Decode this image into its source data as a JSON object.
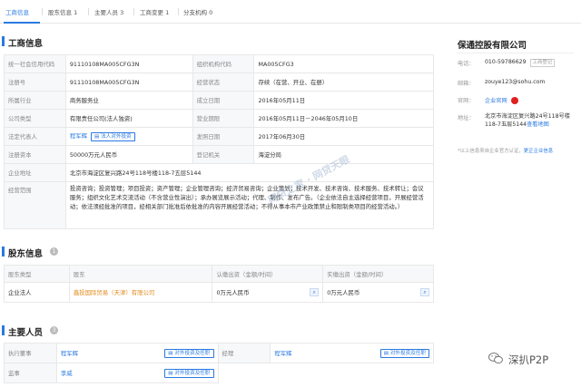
{
  "tabs": [
    {
      "label": "工商信息"
    },
    {
      "label": "股东信息 1"
    },
    {
      "label": "主要人员 3"
    },
    {
      "label": "工商变更 1"
    },
    {
      "label": "分支机构 0"
    }
  ],
  "business": {
    "title": "工商信息",
    "credit_code_label": "统一社会信用代码",
    "credit_code": "91110108MA005CFG3N",
    "org_code_label": "组织机构代码",
    "org_code": "MA005CFG3",
    "reg_no_label": "注册号",
    "reg_no": "91110108MA005CFG3N",
    "status_label": "经营状态",
    "status": "存续（在营、开业、在册）",
    "industry_label": "所属行业",
    "industry": "商务服务业",
    "founded_label": "成立日期",
    "founded": "2016年05月11日",
    "type_label": "公司类型",
    "type": "有限责任公司(法人独资)",
    "term_label": "营业期限",
    "term": "2016年05月11日－2046年05月10日",
    "legal_rep_label": "法定代表人",
    "legal_rep": "程军辉",
    "legal_rep_btn": "法人对外投资",
    "issue_date_label": "发照日期",
    "issue_date": "2017年06月30日",
    "capital_label": "注册资本",
    "capital": "50000万元人民币",
    "authority_label": "登记机关",
    "authority": "海淀分局",
    "address_label": "企业地址",
    "address": "北京市海淀区复兴路24号118号楼118-7五层5144",
    "scope_label": "经营范围",
    "scope": "投资咨询；投资管理；项目投资；资产管理；企业管理咨询；经济贸易咨询；企业策划；技术开发、技术咨询、技术服务、技术转让；会议服务；组织文化艺术交流活动（不含营业性演出）；承办展览展示活动；代理、制作、发布广告。（企业依法自主选择经营项目，开展经营活动；依法须经批准的项目，经相关部门批准后依批准的内容开展经营活动；不得从事本市产业政策禁止和限制类项目的经营活动。）"
  },
  "shareholders": {
    "title": "股东信息",
    "count": "1",
    "headers": [
      "股东类型",
      "股东",
      "认缴出资（金额/时间）",
      "实缴出资（金额/时间）"
    ],
    "rows": [
      {
        "type": "企业法人",
        "name": "鑫投国际贸易（天津）有限公司",
        "subscribed": "0万元人民币",
        "paid": "0万元人民币"
      }
    ]
  },
  "personnel": {
    "title": "主要人员",
    "count": "3",
    "rows": [
      {
        "role1": "执行董事",
        "name1": "程军辉",
        "btn1": "对外投资及任职",
        "role2": "经理",
        "name2": "程军辉",
        "btn2": "对外投资及任职"
      },
      {
        "role1": "监事",
        "name1": "李威",
        "btn1": "对外投资及任职"
      }
    ]
  },
  "company_card": {
    "name": "保通控股有限公司",
    "phone_label": "电话：",
    "phone": "010-59786629",
    "phone_tag": "工商登记",
    "email_label": "邮箱：",
    "email": "zouye123@sohu.com",
    "site_label": "官网：",
    "site": "企业官网",
    "address_label": "地址：",
    "address": "北京市海淀区复兴路24号118号楼118-7五层5144",
    "map_link": "查看地图",
    "footer_note": "*以上信息来自企业官方认证，",
    "footer_link": "更正企业信息"
  },
  "watermark": "网贷之家 · 网贷天眼",
  "brand": "深扒P2P",
  "colors": {
    "accent": "#2a7ae2",
    "orange": "#e08a1a"
  }
}
